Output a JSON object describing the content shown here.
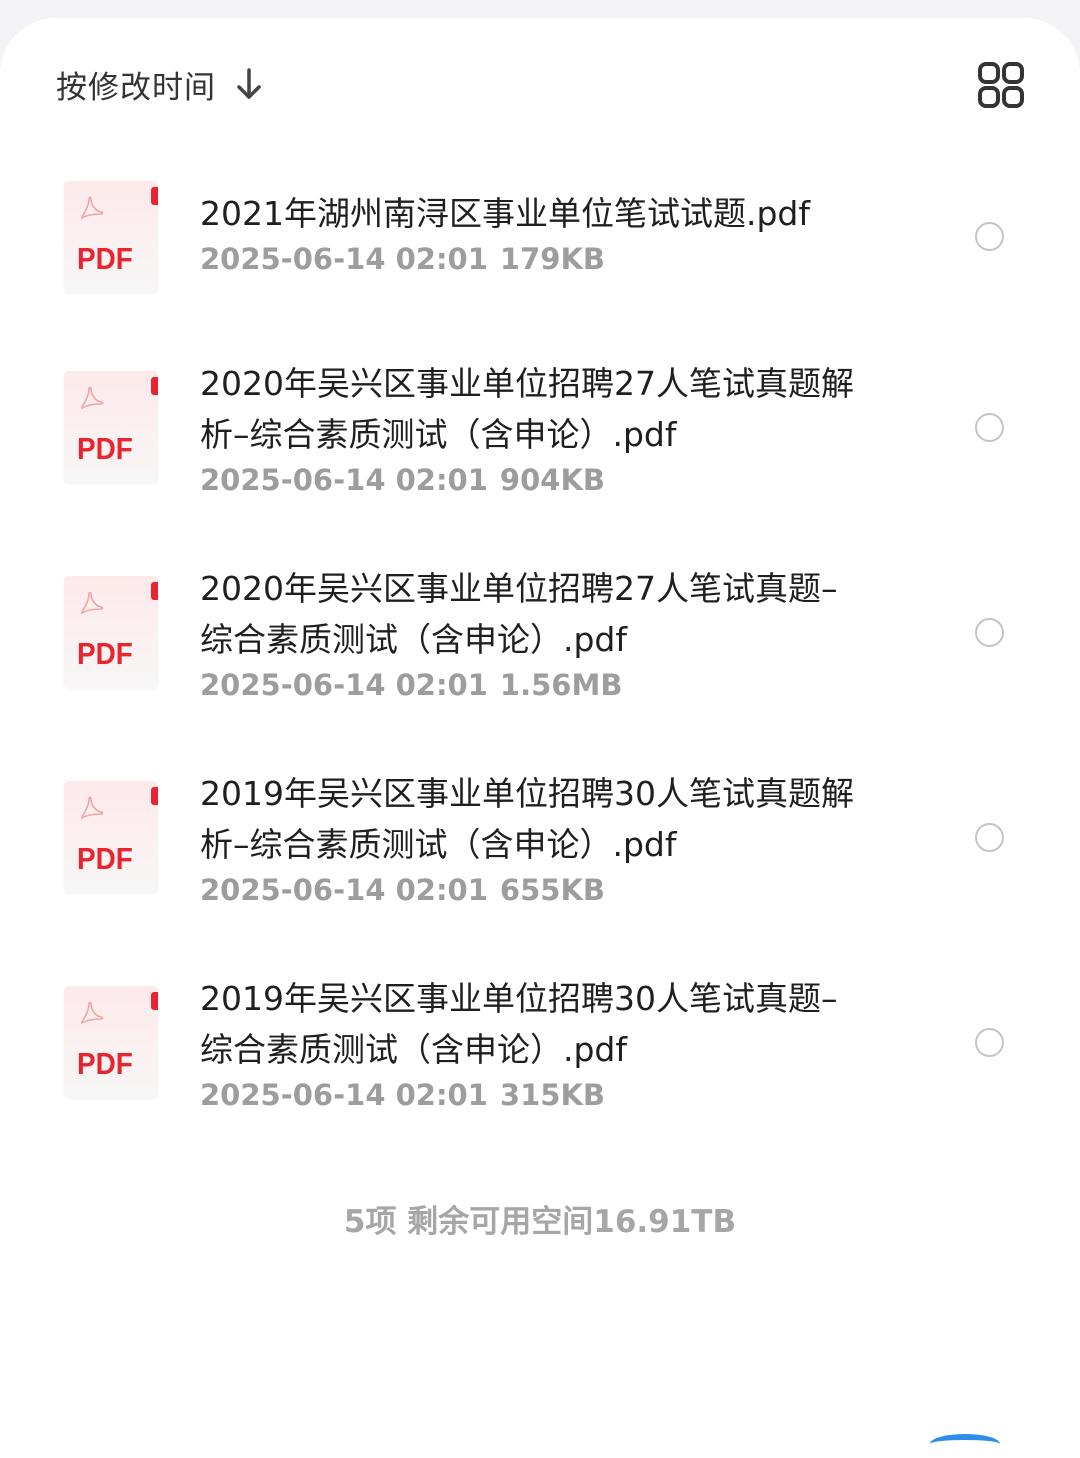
{
  "toolbar": {
    "sort_label": "按修改时间",
    "sort_icon": "arrow-down-icon",
    "view_toggle_icon": "grid-view-icon"
  },
  "files": [
    {
      "icon_text": "PDF",
      "name": "2021年湖州南浔区事业单位笔试试题.pdf",
      "datetime": "2025-06-14 02:01",
      "size": "179KB",
      "selected": false
    },
    {
      "icon_text": "PDF",
      "name": "2020年吴兴区事业单位招聘27人笔试真题解析–综合素质测试（含申论）.pdf",
      "datetime": "2025-06-14 02:01",
      "size": "904KB",
      "selected": false
    },
    {
      "icon_text": "PDF",
      "name": "2020年吴兴区事业单位招聘27人笔试真题–综合素质测试（含申论）.pdf",
      "datetime": "2025-06-14 02:01",
      "size": "1.56MB",
      "selected": false
    },
    {
      "icon_text": "PDF",
      "name": "2019年吴兴区事业单位招聘30人笔试真题解析–综合素质测试（含申论）.pdf",
      "datetime": "2025-06-14 02:01",
      "size": "655KB",
      "selected": false
    },
    {
      "icon_text": "PDF",
      "name": "2019年吴兴区事业单位招聘30人笔试真题–综合素质测试（含申论）.pdf",
      "datetime": "2025-06-14 02:01",
      "size": "315KB",
      "selected": false
    }
  ],
  "footer": {
    "summary": "5项 剩余可用空间16.91TB"
  },
  "colors": {
    "pdf_red": "#e8252f",
    "title_text": "#1f1f1f",
    "meta_text": "#9d9d9d",
    "accent_blue": "#2c8ee8"
  }
}
